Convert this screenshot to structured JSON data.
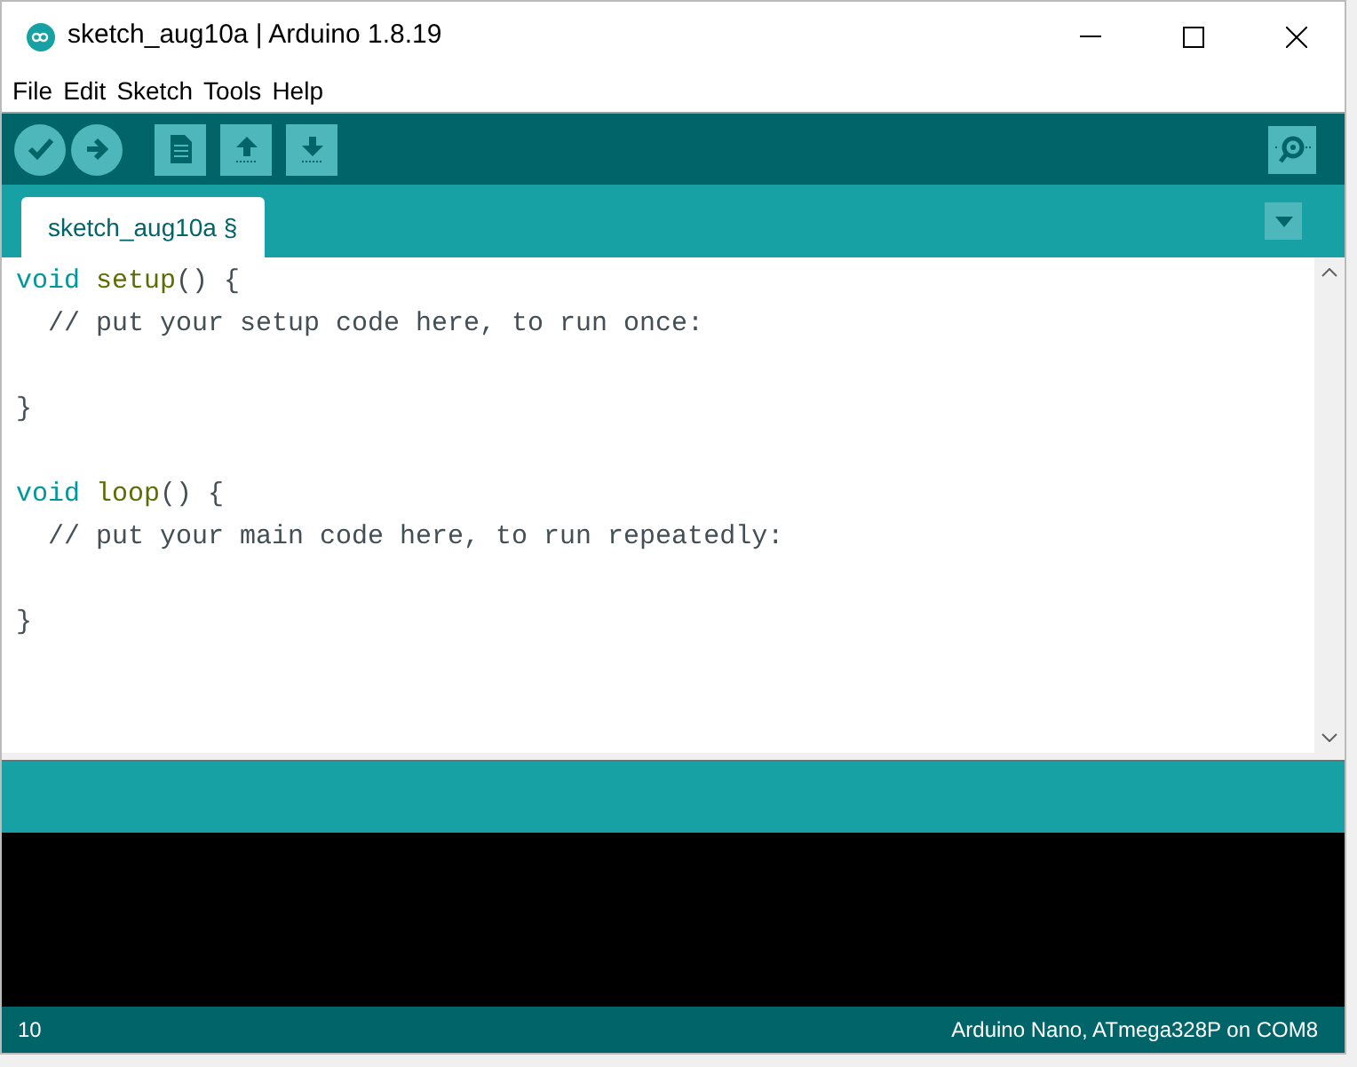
{
  "window": {
    "title": "sketch_aug10a | Arduino 1.8.19"
  },
  "menu": [
    "File",
    "Edit",
    "Sketch",
    "Tools",
    "Help"
  ],
  "tabs": [
    {
      "label": "sketch_aug10a §",
      "selected": true
    }
  ],
  "editor": {
    "lines": [
      {
        "kind": "code",
        "tokens": [
          {
            "text": "void ",
            "kind": "keyword"
          },
          {
            "text": "setup",
            "kind": "function"
          },
          {
            "text": "() {",
            "kind": "plain"
          }
        ]
      },
      {
        "kind": "code",
        "tokens": [
          {
            "text": "  // put your setup code here, to run once:",
            "kind": "comment"
          }
        ]
      },
      {
        "kind": "blank"
      },
      {
        "kind": "code",
        "tokens": [
          {
            "text": "}",
            "kind": "plain"
          }
        ]
      },
      {
        "kind": "blank"
      },
      {
        "kind": "code",
        "tokens": [
          {
            "text": "void ",
            "kind": "keyword"
          },
          {
            "text": "loop",
            "kind": "function"
          },
          {
            "text": "() {",
            "kind": "plain"
          }
        ]
      },
      {
        "kind": "code",
        "tokens": [
          {
            "text": "  // put your main code here, to run repeatedly:",
            "kind": "comment"
          }
        ]
      },
      {
        "kind": "blank"
      },
      {
        "kind": "code",
        "tokens": [
          {
            "text": "}",
            "kind": "plain"
          }
        ]
      }
    ]
  },
  "status_bar": {
    "line": "10",
    "board": "Arduino Nano, ATmega328P on COM8"
  }
}
